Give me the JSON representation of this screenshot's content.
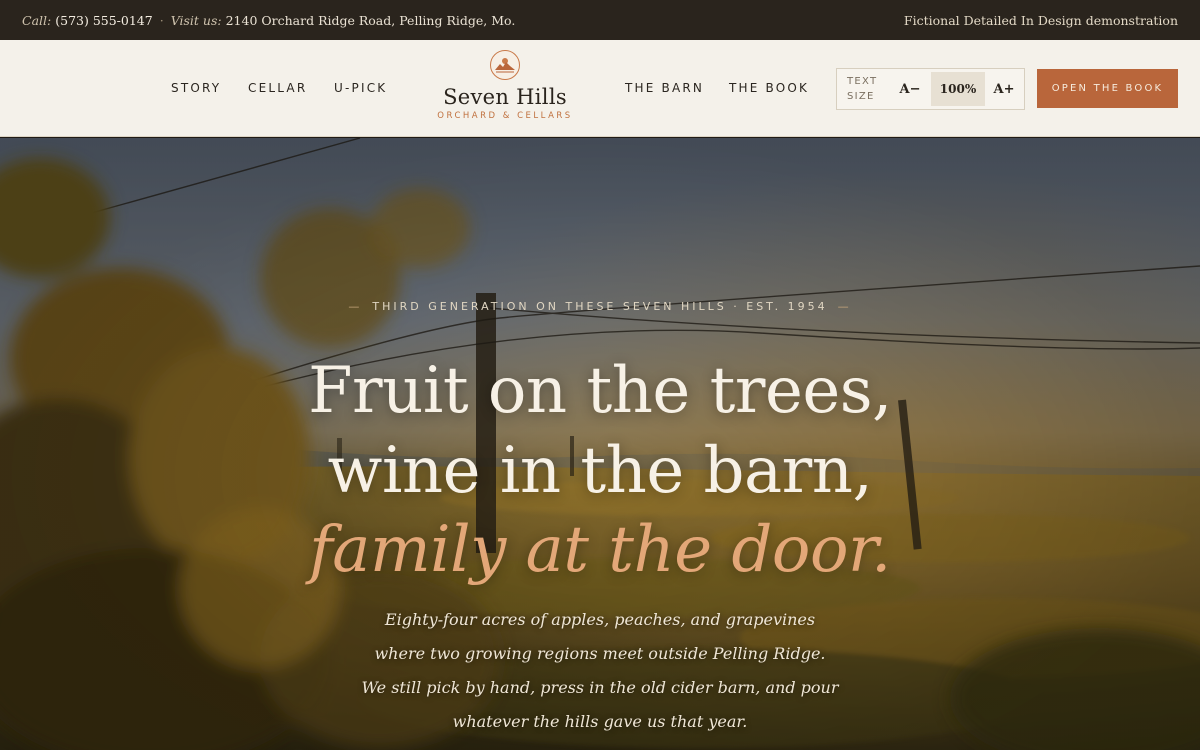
{
  "topbar": {
    "call_label": "Call:",
    "phone": "(573) 555-0147",
    "separator": "·",
    "visit_label": "Visit us:",
    "address": "2140 Orchard Ridge Road, Pelling Ridge, Mo.",
    "demo_note": "Fictional Detailed In Design demonstration"
  },
  "nav": {
    "left": [
      "STORY",
      "CELLAR",
      "U-PICK"
    ],
    "right": [
      "THE BARN",
      "THE BOOK"
    ]
  },
  "logo": {
    "name": "Seven Hills",
    "subtitle": "ORCHARD & CELLARS"
  },
  "text_size": {
    "label": "TEXT SIZE",
    "decrease": "A−",
    "value": "100%",
    "increase": "A+"
  },
  "cta": {
    "label": "OPEN THE BOOK"
  },
  "hero": {
    "eyebrow": "THIRD GENERATION ON THESE SEVEN HILLS · EST. 1954",
    "eyebrow_dash": "—",
    "headline_1": "Fruit on the trees,",
    "headline_2": "wine in the barn,",
    "headline_3": "family at the door.",
    "lede": "Eighty-four acres of apples, peaches, and grapevines where two growing regions meet outside Pelling Ridge. We still pick by hand, press in the old cider barn, and pour whatever the hills gave us that year."
  },
  "colors": {
    "topbar_bg": "#2a241d",
    "header_bg": "#f4f1ea",
    "accent": "#b9663b",
    "headline_accent": "#e3a778"
  }
}
